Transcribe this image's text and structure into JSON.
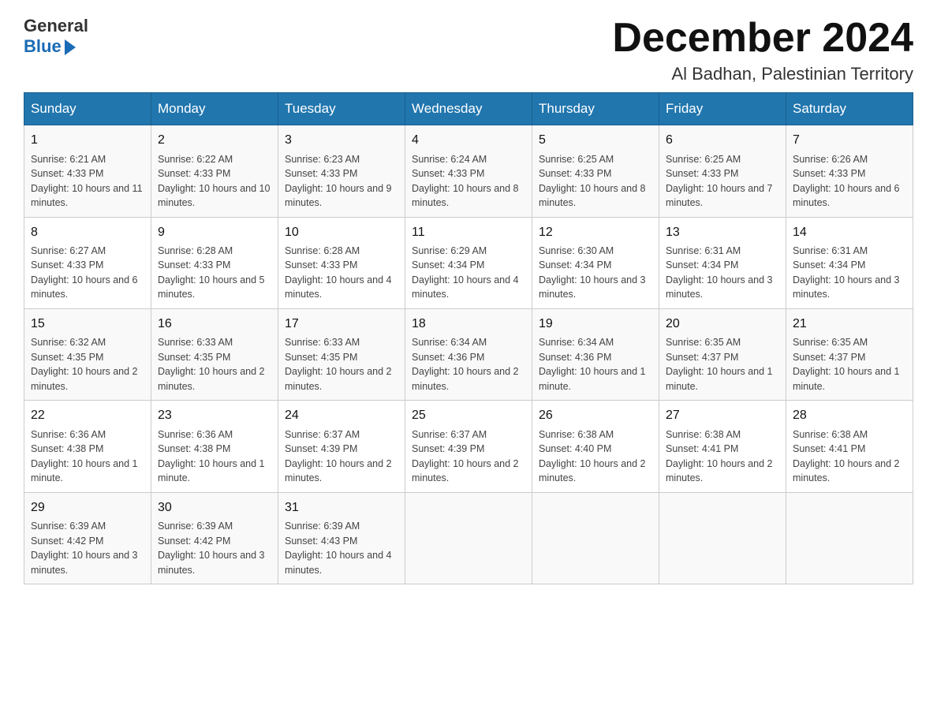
{
  "header": {
    "logo_general": "General",
    "logo_blue": "Blue",
    "month_title": "December 2024",
    "location": "Al Badhan, Palestinian Territory"
  },
  "columns": [
    "Sunday",
    "Monday",
    "Tuesday",
    "Wednesday",
    "Thursday",
    "Friday",
    "Saturday"
  ],
  "weeks": [
    [
      {
        "day": "1",
        "sunrise": "6:21 AM",
        "sunset": "4:33 PM",
        "daylight": "10 hours and 11 minutes."
      },
      {
        "day": "2",
        "sunrise": "6:22 AM",
        "sunset": "4:33 PM",
        "daylight": "10 hours and 10 minutes."
      },
      {
        "day": "3",
        "sunrise": "6:23 AM",
        "sunset": "4:33 PM",
        "daylight": "10 hours and 9 minutes."
      },
      {
        "day": "4",
        "sunrise": "6:24 AM",
        "sunset": "4:33 PM",
        "daylight": "10 hours and 8 minutes."
      },
      {
        "day": "5",
        "sunrise": "6:25 AM",
        "sunset": "4:33 PM",
        "daylight": "10 hours and 8 minutes."
      },
      {
        "day": "6",
        "sunrise": "6:25 AM",
        "sunset": "4:33 PM",
        "daylight": "10 hours and 7 minutes."
      },
      {
        "day": "7",
        "sunrise": "6:26 AM",
        "sunset": "4:33 PM",
        "daylight": "10 hours and 6 minutes."
      }
    ],
    [
      {
        "day": "8",
        "sunrise": "6:27 AM",
        "sunset": "4:33 PM",
        "daylight": "10 hours and 6 minutes."
      },
      {
        "day": "9",
        "sunrise": "6:28 AM",
        "sunset": "4:33 PM",
        "daylight": "10 hours and 5 minutes."
      },
      {
        "day": "10",
        "sunrise": "6:28 AM",
        "sunset": "4:33 PM",
        "daylight": "10 hours and 4 minutes."
      },
      {
        "day": "11",
        "sunrise": "6:29 AM",
        "sunset": "4:34 PM",
        "daylight": "10 hours and 4 minutes."
      },
      {
        "day": "12",
        "sunrise": "6:30 AM",
        "sunset": "4:34 PM",
        "daylight": "10 hours and 3 minutes."
      },
      {
        "day": "13",
        "sunrise": "6:31 AM",
        "sunset": "4:34 PM",
        "daylight": "10 hours and 3 minutes."
      },
      {
        "day": "14",
        "sunrise": "6:31 AM",
        "sunset": "4:34 PM",
        "daylight": "10 hours and 3 minutes."
      }
    ],
    [
      {
        "day": "15",
        "sunrise": "6:32 AM",
        "sunset": "4:35 PM",
        "daylight": "10 hours and 2 minutes."
      },
      {
        "day": "16",
        "sunrise": "6:33 AM",
        "sunset": "4:35 PM",
        "daylight": "10 hours and 2 minutes."
      },
      {
        "day": "17",
        "sunrise": "6:33 AM",
        "sunset": "4:35 PM",
        "daylight": "10 hours and 2 minutes."
      },
      {
        "day": "18",
        "sunrise": "6:34 AM",
        "sunset": "4:36 PM",
        "daylight": "10 hours and 2 minutes."
      },
      {
        "day": "19",
        "sunrise": "6:34 AM",
        "sunset": "4:36 PM",
        "daylight": "10 hours and 1 minute."
      },
      {
        "day": "20",
        "sunrise": "6:35 AM",
        "sunset": "4:37 PM",
        "daylight": "10 hours and 1 minute."
      },
      {
        "day": "21",
        "sunrise": "6:35 AM",
        "sunset": "4:37 PM",
        "daylight": "10 hours and 1 minute."
      }
    ],
    [
      {
        "day": "22",
        "sunrise": "6:36 AM",
        "sunset": "4:38 PM",
        "daylight": "10 hours and 1 minute."
      },
      {
        "day": "23",
        "sunrise": "6:36 AM",
        "sunset": "4:38 PM",
        "daylight": "10 hours and 1 minute."
      },
      {
        "day": "24",
        "sunrise": "6:37 AM",
        "sunset": "4:39 PM",
        "daylight": "10 hours and 2 minutes."
      },
      {
        "day": "25",
        "sunrise": "6:37 AM",
        "sunset": "4:39 PM",
        "daylight": "10 hours and 2 minutes."
      },
      {
        "day": "26",
        "sunrise": "6:38 AM",
        "sunset": "4:40 PM",
        "daylight": "10 hours and 2 minutes."
      },
      {
        "day": "27",
        "sunrise": "6:38 AM",
        "sunset": "4:41 PM",
        "daylight": "10 hours and 2 minutes."
      },
      {
        "day": "28",
        "sunrise": "6:38 AM",
        "sunset": "4:41 PM",
        "daylight": "10 hours and 2 minutes."
      }
    ],
    [
      {
        "day": "29",
        "sunrise": "6:39 AM",
        "sunset": "4:42 PM",
        "daylight": "10 hours and 3 minutes."
      },
      {
        "day": "30",
        "sunrise": "6:39 AM",
        "sunset": "4:42 PM",
        "daylight": "10 hours and 3 minutes."
      },
      {
        "day": "31",
        "sunrise": "6:39 AM",
        "sunset": "4:43 PM",
        "daylight": "10 hours and 4 minutes."
      },
      null,
      null,
      null,
      null
    ]
  ]
}
